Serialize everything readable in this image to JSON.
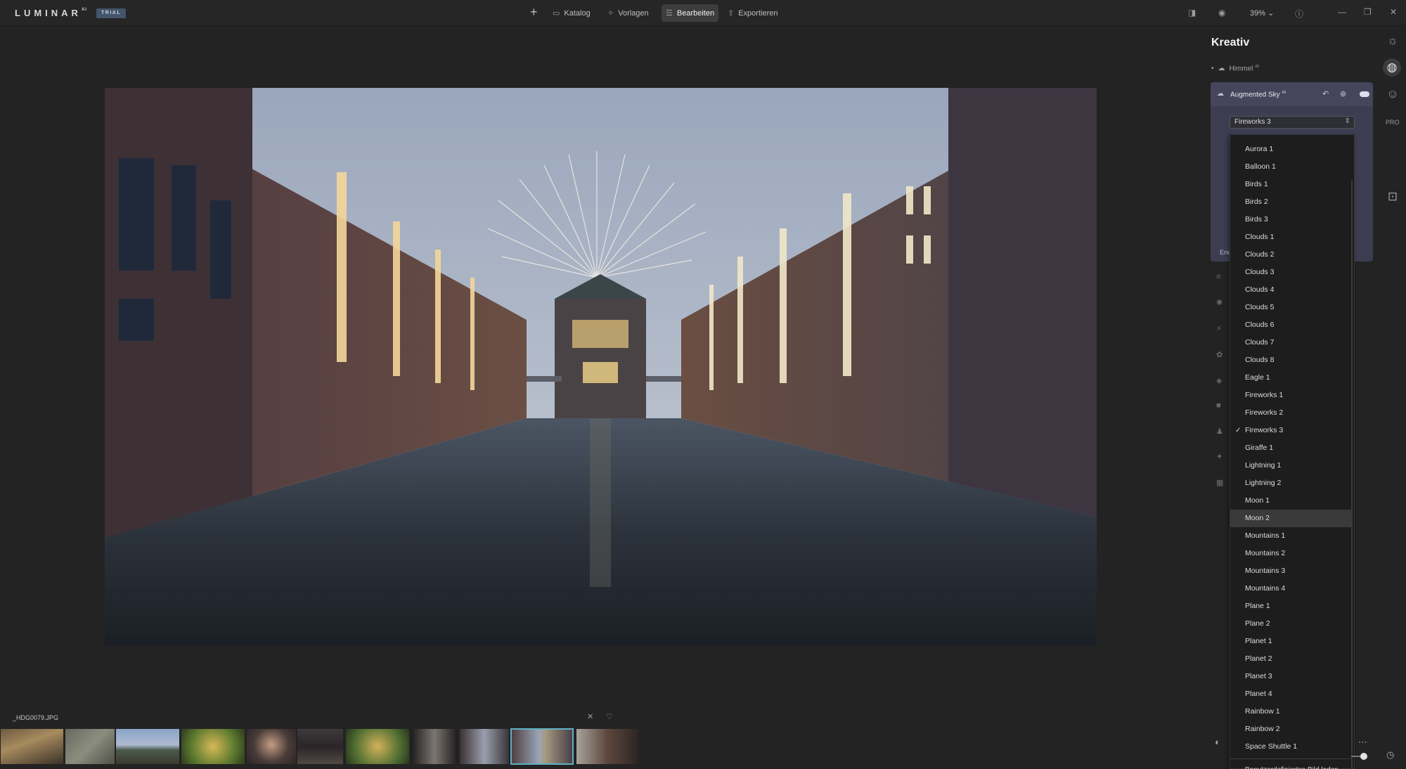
{
  "app": {
    "logo": "LUMINAR",
    "logo_sup": "AI",
    "badge": "TRIAL"
  },
  "toolbar": {
    "add_label": "+",
    "catalog_label": "Katalog",
    "templates_label": "Vorlagen",
    "edit_label": "Bearbeiten",
    "export_label": "Exportieren",
    "zoom": "39%"
  },
  "filmstrip": {
    "filename": "_HDG0079.JPG",
    "selected_index": 9
  },
  "panel": {
    "title": "Kreativ",
    "sky_section": "Himmel",
    "sky_ai_sup": "AI",
    "tool_name": "Augmented Sky",
    "tool_ai_sup": "AI",
    "selected_object": "Fireworks 3",
    "collapsed_label": "Erw"
  },
  "dropdown": {
    "items": [
      "Aurora 1",
      "Balloon 1",
      "Birds 1",
      "Birds 2",
      "Birds 3",
      "Clouds 1",
      "Clouds 2",
      "Clouds 3",
      "Clouds 4",
      "Clouds 5",
      "Clouds 6",
      "Clouds 7",
      "Clouds 8",
      "Eagle 1",
      "Fireworks 1",
      "Fireworks 2",
      "Fireworks 3",
      "Giraffe 1",
      "Lightning 1",
      "Lightning 2",
      "Moon 1",
      "Moon 2",
      "Mountains 1",
      "Mountains 2",
      "Mountains 3",
      "Mountains 4",
      "Plane 1",
      "Plane 2",
      "Planet 1",
      "Planet 2",
      "Planet 3",
      "Planet 4",
      "Rainbow 1",
      "Rainbow 2",
      "Space Shuttle 1"
    ],
    "checked": "Fireworks 3",
    "hovered": "Moon 2",
    "custom_label": "Benutzerdefiniertes Bild laden..."
  },
  "icons": {
    "catalog": "folder-icon",
    "templates": "sparkle-icon",
    "edit": "sliders-icon",
    "export": "share-icon"
  }
}
